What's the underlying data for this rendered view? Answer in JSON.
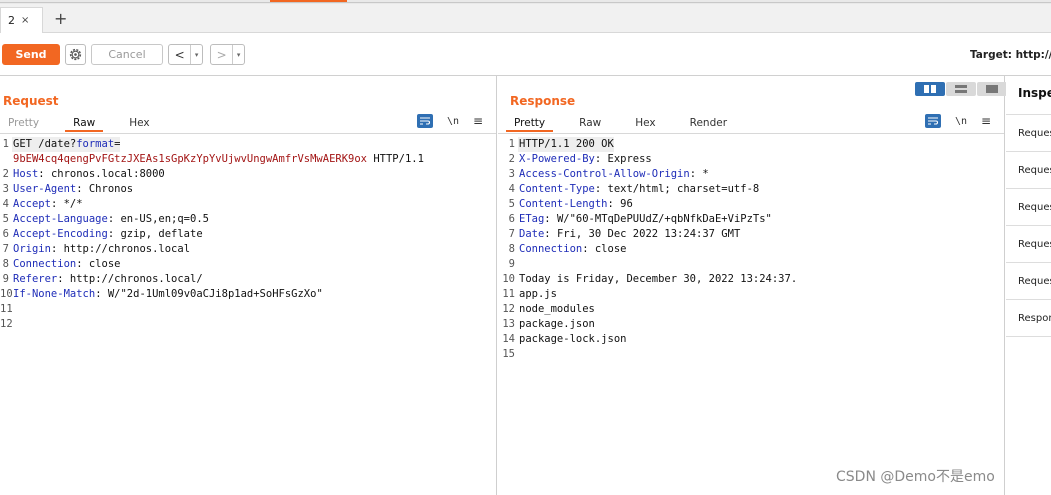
{
  "tabs": {
    "current": {
      "label": "2",
      "close": "×"
    },
    "new_tab": "+"
  },
  "toolbar": {
    "send_label": "Send",
    "cancel_label": "Cancel",
    "back_arrow": "<",
    "forward_arrow": ">",
    "dropdown_glyph": "▾",
    "target_label": "Target: http://ch"
  },
  "request": {
    "title": "Request",
    "tabs": [
      "Pretty",
      "Raw",
      "Hex"
    ],
    "active_tab": "Raw",
    "newline_toggle": "\\n",
    "menu_glyph": "≡",
    "lines": [
      {
        "num": "1",
        "parts": [
          {
            "t": "GET /date?",
            "c": "plain"
          },
          {
            "t": "format",
            "c": "hdr-name"
          },
          {
            "t": "=",
            "c": "plain"
          }
        ]
      },
      {
        "num": "",
        "parts": [
          {
            "t": "9bEW4cq4qengPvFGtzJXEAs1sGpKzYpYvUjwvUngwAmfrVsMwAERK9ox",
            "c": "kw-red"
          },
          {
            "t": " HTTP/1.1",
            "c": "plain"
          }
        ]
      },
      {
        "num": "2",
        "parts": [
          {
            "t": "Host",
            "c": "hdr-name"
          },
          {
            "t": ": chronos.local:8000",
            "c": "plain"
          }
        ]
      },
      {
        "num": "3",
        "parts": [
          {
            "t": "User-Agent",
            "c": "hdr-name"
          },
          {
            "t": ": Chronos",
            "c": "plain"
          }
        ]
      },
      {
        "num": "4",
        "parts": [
          {
            "t": "Accept",
            "c": "hdr-name"
          },
          {
            "t": ": */*",
            "c": "plain"
          }
        ]
      },
      {
        "num": "5",
        "parts": [
          {
            "t": "Accept-Language",
            "c": "hdr-name"
          },
          {
            "t": ": en-US,en;q=0.5",
            "c": "plain"
          }
        ]
      },
      {
        "num": "6",
        "parts": [
          {
            "t": "Accept-Encoding",
            "c": "hdr-name"
          },
          {
            "t": ": gzip, deflate",
            "c": "plain"
          }
        ]
      },
      {
        "num": "7",
        "parts": [
          {
            "t": "Origin",
            "c": "hdr-name"
          },
          {
            "t": ": http://chronos.local",
            "c": "plain"
          }
        ]
      },
      {
        "num": "8",
        "parts": [
          {
            "t": "Connection",
            "c": "hdr-name"
          },
          {
            "t": ": close",
            "c": "plain"
          }
        ]
      },
      {
        "num": "9",
        "parts": [
          {
            "t": "Referer",
            "c": "hdr-name"
          },
          {
            "t": ": http://chronos.local/",
            "c": "plain"
          }
        ]
      },
      {
        "num": "10",
        "parts": [
          {
            "t": "If-None-Match",
            "c": "hdr-name"
          },
          {
            "t": ": W/\"2d-1Uml09v0aCJi8p1ad+SoHFsGzXo\"",
            "c": "plain"
          }
        ]
      },
      {
        "num": "11",
        "parts": []
      },
      {
        "num": "12",
        "parts": []
      }
    ]
  },
  "response": {
    "title": "Response",
    "tabs": [
      "Pretty",
      "Raw",
      "Hex",
      "Render"
    ],
    "active_tab": "Pretty",
    "newline_toggle": "\\n",
    "menu_glyph": "≡",
    "lines": [
      {
        "num": "1",
        "parts": [
          {
            "t": "HTTP/1.1 200 OK",
            "c": "plain"
          }
        ]
      },
      {
        "num": "2",
        "parts": [
          {
            "t": "X-Powered-By",
            "c": "hdr-name"
          },
          {
            "t": ": Express",
            "c": "plain"
          }
        ]
      },
      {
        "num": "3",
        "parts": [
          {
            "t": "Access-Control-Allow-Origin",
            "c": "hdr-name"
          },
          {
            "t": ": *",
            "c": "plain"
          }
        ]
      },
      {
        "num": "4",
        "parts": [
          {
            "t": "Content-Type",
            "c": "hdr-name"
          },
          {
            "t": ": text/html; charset=utf-8",
            "c": "plain"
          }
        ]
      },
      {
        "num": "5",
        "parts": [
          {
            "t": "Content-Length",
            "c": "hdr-name"
          },
          {
            "t": ": 96",
            "c": "plain"
          }
        ]
      },
      {
        "num": "6",
        "parts": [
          {
            "t": "ETag",
            "c": "hdr-name"
          },
          {
            "t": ": W/\"60-MTqDePUUdZ/+qbNfkDaE+ViPzTs\"",
            "c": "plain"
          }
        ]
      },
      {
        "num": "7",
        "parts": [
          {
            "t": "Date",
            "c": "hdr-name"
          },
          {
            "t": ": Fri, 30 Dec 2022 13:24:37 GMT",
            "c": "plain"
          }
        ]
      },
      {
        "num": "8",
        "parts": [
          {
            "t": "Connection",
            "c": "hdr-name"
          },
          {
            "t": ": close",
            "c": "plain"
          }
        ]
      },
      {
        "num": "9",
        "parts": []
      },
      {
        "num": "10",
        "parts": [
          {
            "t": "Today is Friday, December 30, 2022 13:24:37.",
            "c": "plain"
          }
        ]
      },
      {
        "num": "11",
        "parts": [
          {
            "t": "app.js",
            "c": "plain"
          }
        ]
      },
      {
        "num": "12",
        "parts": [
          {
            "t": "node_modules",
            "c": "plain"
          }
        ]
      },
      {
        "num": "13",
        "parts": [
          {
            "t": "package.json",
            "c": "plain"
          }
        ]
      },
      {
        "num": "14",
        "parts": [
          {
            "t": "package-lock.json",
            "c": "plain"
          }
        ]
      },
      {
        "num": "15",
        "parts": []
      }
    ]
  },
  "inspector": {
    "title": "Inspector",
    "items": [
      "Request attributes",
      "Request query parameters",
      "Request body parameters",
      "Request cookies",
      "Request headers",
      "Response headers"
    ]
  },
  "watermark": "CSDN @Demo不是emo",
  "colors": {
    "accent": "#f26722",
    "header_name": "#1f2db8",
    "param_value": "#a31515",
    "toggle_active": "#2f6fb3"
  }
}
